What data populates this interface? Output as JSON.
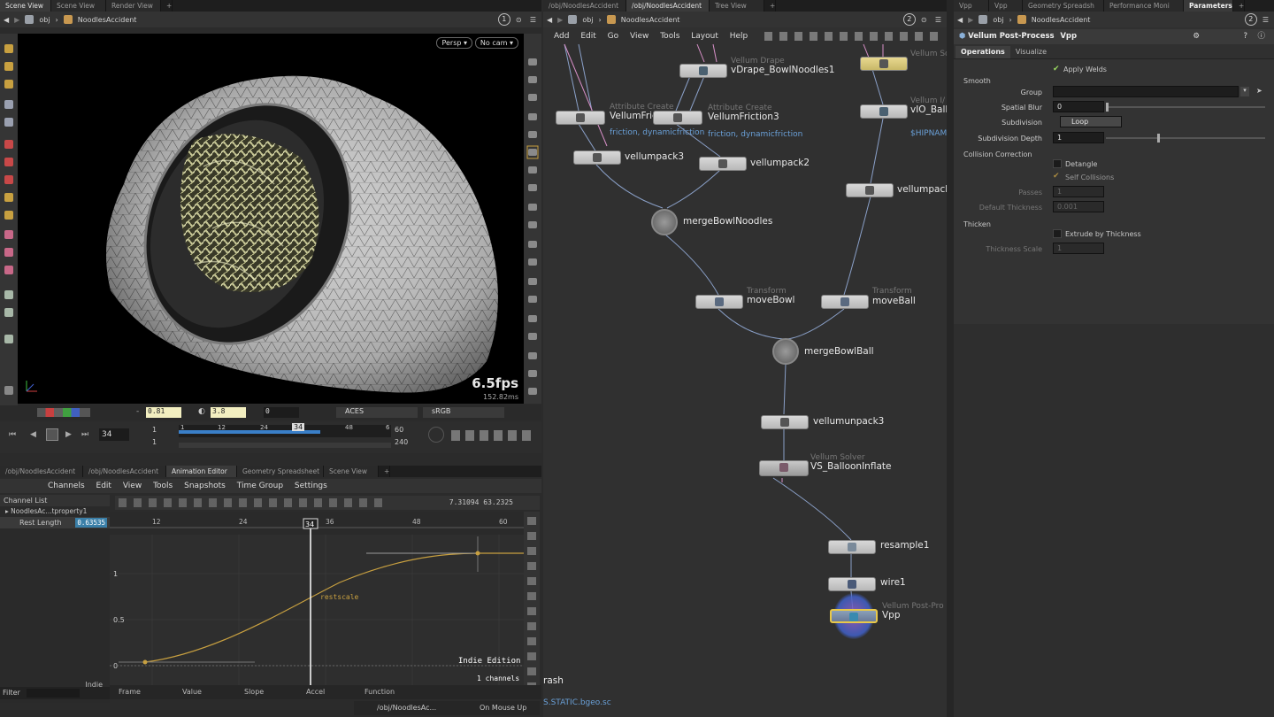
{
  "scene_view": {
    "tabs": [
      "Scene View",
      "Scene View",
      "Render View"
    ],
    "path": {
      "context": "obj",
      "node": "NoodlesAccident",
      "pane_number": "1"
    },
    "camera": {
      "persp": "Persp ▾",
      "cam": "No cam ▾"
    },
    "fps": "6.5fps",
    "indie_text": "Indie Edition",
    "frame_time": "152.82ms",
    "display_bar": {
      "value1": "0.81",
      "value2": "3.8",
      "value3": "0",
      "color_space": "ACES",
      "display": "sRGB"
    },
    "playbar": {
      "current_frame": "34",
      "start": "1",
      "start2": "1",
      "end": "60",
      "end2": "240",
      "ticks": [
        "1",
        "12",
        "24",
        "34",
        "48",
        "6"
      ]
    }
  },
  "animation_editor": {
    "tabs": [
      "/obj/NoodlesAccident",
      "/obj/NoodlesAccident",
      "Animation Editor",
      "Geometry Spreadsheet",
      "Scene View"
    ],
    "menu": [
      "Channels",
      "Edit",
      "View",
      "Tools",
      "Snapshots",
      "Time Group",
      "Settings"
    ],
    "channel_list_title": "Channel List",
    "channel_node": "NoodlesAc...tproperty1",
    "channel_name": "Rest Length",
    "channel_value": "0.63535",
    "coords": "7.31094  63.2325",
    "ruler_ticks": [
      "12",
      "24",
      "34",
      "36",
      "48",
      "60"
    ],
    "y_ticks": [
      "1",
      "0.5",
      "0"
    ],
    "curve_label": "restscale",
    "indie": "Indie Edition",
    "channels_count": "1 channels",
    "indie_left": "Indie",
    "filter_label": "Filter",
    "bottom_labels": [
      "Frame",
      "Value",
      "Slope",
      "Accel",
      "Function"
    ]
  },
  "network": {
    "tabs": [
      "/obj/NoodlesAccident",
      "/obj/NoodlesAccident",
      "Tree View"
    ],
    "path": {
      "context": "obj",
      "node": "NoodlesAccident",
      "pane_number": "2"
    },
    "menu": [
      "Add",
      "Edit",
      "Go",
      "View",
      "Tools",
      "Layout",
      "Help"
    ],
    "nodes": {
      "vdrape_type": "Vellum Drape",
      "vdrape": "vDrape_BowlNoodles1",
      "vsol_type": "Vellum So",
      "vio_type": "Vellum I/",
      "vio": "vIO_Ball",
      "hipname": "$HIPNAM",
      "attr1_type": "Attribute Create",
      "attr1": "VellumFric",
      "attr1_sub": "friction, dynamicfriction",
      "attr2_type": "Attribute Create",
      "attr2": "VellumFriction3",
      "attr2_sub": "friction, dynamicfriction",
      "pack3": "vellumpack3",
      "pack2": "vellumpack2",
      "pack_r": "vellumpack",
      "merge1": "mergeBowlNoodles",
      "t1_type": "Transform",
      "t1": "moveBowl",
      "t2_type": "Transform",
      "t2": "moveBall",
      "merge2": "mergeBowlBall",
      "unpack": "vellumunpack3",
      "solver_type": "Vellum Solver",
      "solver": "VS_BalloonInflate",
      "resample": "resample1",
      "wire": "wire1",
      "vpp_type": "Vellum Post-Pro",
      "vpp": "Vpp",
      "crash": "rash",
      "bgeo": "S.STATIC.bgeo.sc"
    }
  },
  "parameters": {
    "tabs": [
      "Vpp",
      "Vpp",
      "Geometry Spreadsh",
      "Performance Moni",
      "Parameters"
    ],
    "path": {
      "context": "obj",
      "node": "NoodlesAccident",
      "pane_number": "2"
    },
    "node_type": "Vellum Post-Process",
    "node_name": "Vpp",
    "subtabs": [
      "Operations",
      "Visualize"
    ],
    "apply_welds": "Apply Welds",
    "smooth_header": "Smooth",
    "group_label": "Group",
    "spatial_blur_label": "Spatial Blur",
    "spatial_blur_value": "0",
    "subdivision_label": "Subdivision",
    "subdivision_value": "Loop",
    "subdivision_depth_label": "Subdivision Depth",
    "subdivision_depth_value": "1",
    "collision_header": "Collision Correction",
    "detangle": "Detangle",
    "self_collisions": "Self Collisions",
    "passes_label": "Passes",
    "passes_value": "1",
    "default_thickness_label": "Default Thickness",
    "default_thickness_value": "0.001",
    "thicken_header": "Thicken",
    "extrude": "Extrude by Thickness",
    "thickness_scale_label": "Thickness Scale",
    "thickness_scale_value": "1"
  },
  "status_bar": {
    "path": "/obj/NoodlesAc...",
    "mode": "On Mouse Up"
  },
  "colors": {
    "accent_blue": "#3a7fc8",
    "node_selected": "#e8c84a",
    "pink_wire": "#d890c8",
    "curve": "#c8a040",
    "label_blue": "#6aa0d8"
  }
}
